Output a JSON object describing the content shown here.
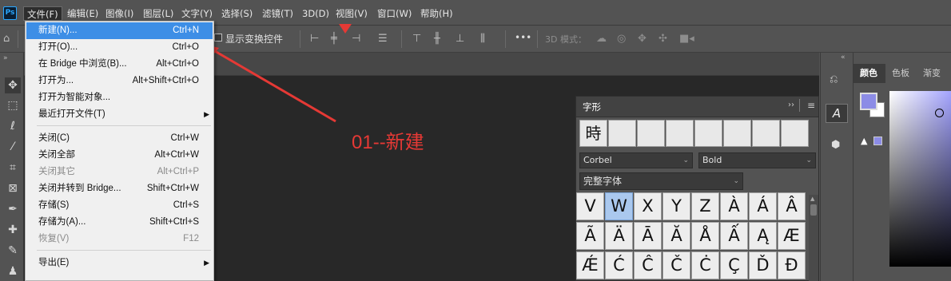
{
  "app": {
    "logo": "Ps",
    "brand_color": "#2aa7ff"
  },
  "menubar": [
    "文件(F)",
    "编辑(E)",
    "图像(I)",
    "图层(L)",
    "文字(Y)",
    "选择(S)",
    "滤镜(T)",
    "3D(D)",
    "视图(V)",
    "窗口(W)",
    "帮助(H)"
  ],
  "options_bar": {
    "show_transform_label": "显示变换控件",
    "more_label": "•••",
    "mode_3d_label": "3D 模式："
  },
  "file_menu": [
    {
      "label": "新建(N)...",
      "shortcut": "Ctrl+N",
      "highlighted": true
    },
    {
      "label": "打开(O)...",
      "shortcut": "Ctrl+O"
    },
    {
      "label": "在 Bridge 中浏览(B)...",
      "shortcut": "Alt+Ctrl+O"
    },
    {
      "label": "打开为...",
      "shortcut": "Alt+Shift+Ctrl+O"
    },
    {
      "label": "打开为智能对象...",
      "shortcut": ""
    },
    {
      "label": "最近打开文件(T)",
      "shortcut": "",
      "submenu": true
    },
    {
      "separator": true
    },
    {
      "label": "关闭(C)",
      "shortcut": "Ctrl+W"
    },
    {
      "label": "关闭全部",
      "shortcut": "Alt+Ctrl+W"
    },
    {
      "label": "关闭其它",
      "shortcut": "Alt+Ctrl+P",
      "disabled": true
    },
    {
      "label": "关闭并转到 Bridge...",
      "shortcut": "Shift+Ctrl+W"
    },
    {
      "label": "存储(S)",
      "shortcut": "Ctrl+S"
    },
    {
      "label": "存储为(A)...",
      "shortcut": "Shift+Ctrl+S"
    },
    {
      "label": "恢复(V)",
      "shortcut": "F12",
      "disabled": true
    },
    {
      "separator": true
    },
    {
      "label": "导出(E)",
      "shortcut": "",
      "submenu": true
    }
  ],
  "annotation": {
    "text": "01--新建",
    "color": "#e53935"
  },
  "glyphs_panel": {
    "title": "字形",
    "recent": [
      "時",
      "",
      "",
      "",
      "",
      "",
      "",
      ""
    ],
    "font_family": "Corbel",
    "font_style": "Bold",
    "filter": "完整字体",
    "rows": [
      [
        "V",
        "W",
        "X",
        "Y",
        "Z",
        "À",
        "Á",
        "Â"
      ],
      [
        "Ã",
        "Ä",
        "Ā",
        "Ă",
        "Å",
        "Ấ",
        "Ą",
        "Æ"
      ],
      [
        "Ǽ",
        "Ć",
        "Ĉ",
        "Č",
        "Ċ",
        "Ç",
        "Ď",
        "Đ"
      ]
    ],
    "selected": "W"
  },
  "right_panel": {
    "tabs": [
      "颜色",
      "色板",
      "渐变"
    ],
    "active_tab": "颜色",
    "foreground": "#8c8ce6",
    "background": "#ffffff"
  },
  "tools": [
    "move-icon",
    "marquee-icon",
    "lasso-icon",
    "magic-wand-icon",
    "crop-icon",
    "frame-icon",
    "eyedropper-icon",
    "healing-icon",
    "brush-icon",
    "stamp-icon"
  ]
}
